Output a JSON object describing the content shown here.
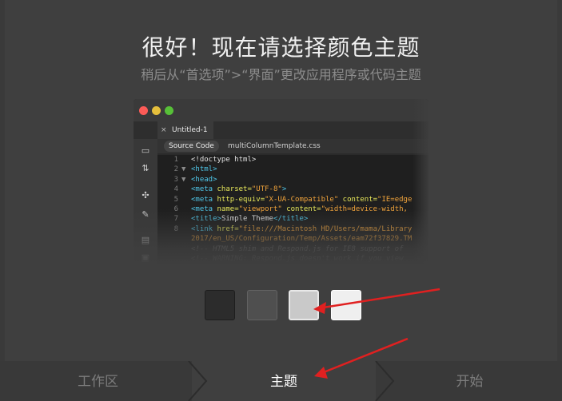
{
  "header": {
    "title": "很好！现在请选择颜色主题",
    "subtitle": "稍后从“首选项”>“界面”更改应用程序或代码主题"
  },
  "preview": {
    "tab_label": "Untitled-1",
    "tab_close": "×",
    "source_button": "Source Code",
    "related_file": "multiColumnTemplate.css",
    "code_lines": [
      {
        "num": "1",
        "fold": "",
        "parts": [
          {
            "t": "<!doctype html>",
            "c": "white"
          }
        ]
      },
      {
        "num": "2",
        "fold": "▼",
        "parts": [
          {
            "t": "<html>",
            "c": "tag"
          }
        ]
      },
      {
        "num": "3",
        "fold": "▼",
        "parts": [
          {
            "t": "<head>",
            "c": "tag"
          }
        ]
      },
      {
        "num": "4",
        "fold": "",
        "parts": [
          {
            "t": "<meta ",
            "c": "tag"
          },
          {
            "t": "charset=",
            "c": "attr"
          },
          {
            "t": "\"UTF-8\"",
            "c": "val"
          },
          {
            "t": ">",
            "c": "tag"
          }
        ]
      },
      {
        "num": "5",
        "fold": "",
        "parts": [
          {
            "t": "<meta ",
            "c": "tag"
          },
          {
            "t": "http-equiv=",
            "c": "attr"
          },
          {
            "t": "\"X-UA-Compatible\"",
            "c": "val"
          },
          {
            "t": " content=",
            "c": "attr"
          },
          {
            "t": "\"IE=edge",
            "c": "val"
          }
        ]
      },
      {
        "num": "6",
        "fold": "",
        "parts": [
          {
            "t": "<meta ",
            "c": "tag"
          },
          {
            "t": "name=",
            "c": "attr"
          },
          {
            "t": "\"viewport\"",
            "c": "val"
          },
          {
            "t": " content=",
            "c": "attr"
          },
          {
            "t": "\"width=device-width,",
            "c": "val"
          }
        ]
      },
      {
        "num": "7",
        "fold": "",
        "parts": [
          {
            "t": "<title>",
            "c": "tag"
          },
          {
            "t": "Simple Theme",
            "c": "white"
          },
          {
            "t": "</title>",
            "c": "tag"
          }
        ]
      },
      {
        "num": "8",
        "fold": "",
        "parts": [
          {
            "t": "<link ",
            "c": "tag"
          },
          {
            "t": "href=",
            "c": "attr"
          },
          {
            "t": "\"file:///Macintosh HD/Users/mama/Library",
            "c": "val"
          }
        ]
      },
      {
        "num": "",
        "fold": "",
        "parts": [
          {
            "t": "2017/en_US/Configuration/Temp/Assets/eam72f37829.TM",
            "c": "val"
          }
        ]
      },
      {
        "num": "",
        "fold": "",
        "parts": [
          {
            "t": "<!-- HTML5 shim and Respond.js for IE8 support of",
            "c": "com"
          }
        ]
      },
      {
        "num": "",
        "fold": "",
        "parts": [
          {
            "t": "<!-- WARNING: Respond.js doesn't work if you view",
            "c": "com"
          }
        ]
      }
    ]
  },
  "themes": [
    {
      "name": "darkest",
      "color": "#2c2c2c"
    },
    {
      "name": "dark",
      "color": "#4f4f4f"
    },
    {
      "name": "light",
      "color": "#c9c9c9"
    },
    {
      "name": "lightest",
      "color": "#efefef"
    }
  ],
  "steps": {
    "workspace": "工作区",
    "theme": "主题",
    "start": "开始"
  },
  "colors": {
    "annotation_arrow": "#e02020",
    "selected_step": "#ffffff"
  }
}
